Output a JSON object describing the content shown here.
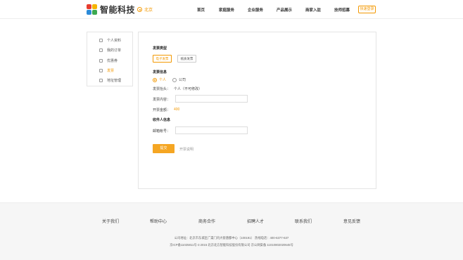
{
  "header": {
    "brand": "智能科技",
    "city": "北京",
    "nav": [
      "首页",
      "家庭服务",
      "企业服务",
      "产品展示",
      "商家入驻",
      "技师招募"
    ],
    "quick_login": "快速登录"
  },
  "sidebar": {
    "items": [
      {
        "label": "个人资料",
        "icon": "user-icon"
      },
      {
        "label": "我的订单",
        "icon": "order-icon"
      },
      {
        "label": "优惠券",
        "icon": "coupon-icon"
      },
      {
        "label": "发票",
        "icon": "invoice-icon",
        "active": true
      },
      {
        "label": "地址管理",
        "icon": "address-icon"
      }
    ]
  },
  "invoice": {
    "type_title": "发票类型",
    "type_options": [
      "电子发票",
      "纸质发票"
    ],
    "info_title": "发票信息",
    "personal": "个人",
    "company": "公司",
    "header_label": "发票抬头：",
    "header_value": "个人（不可修改）",
    "content_label": "发票内容：",
    "content_value": "",
    "amount_label": "开票金额：",
    "amount_value": "400",
    "receiver_title": "收件人信息",
    "email_label": "邮箱帐号：",
    "email_value": "",
    "submit": "提交",
    "explain": "开票说明"
  },
  "footer": {
    "links": [
      "关于我们",
      "帮助中心",
      "商务合作",
      "招聘人才",
      "联系我们",
      "意见反馈"
    ],
    "address_line": "公司地址：北京市东城区广渠门内大街唐都中心（100191）   热线电话：400-6377-637",
    "icp_line": "京ICP备11025811号-3 2015 北京北方智能科技股份有限公司 京公网安备 11010802020645号"
  },
  "colors": {
    "accent": "#f39800"
  }
}
